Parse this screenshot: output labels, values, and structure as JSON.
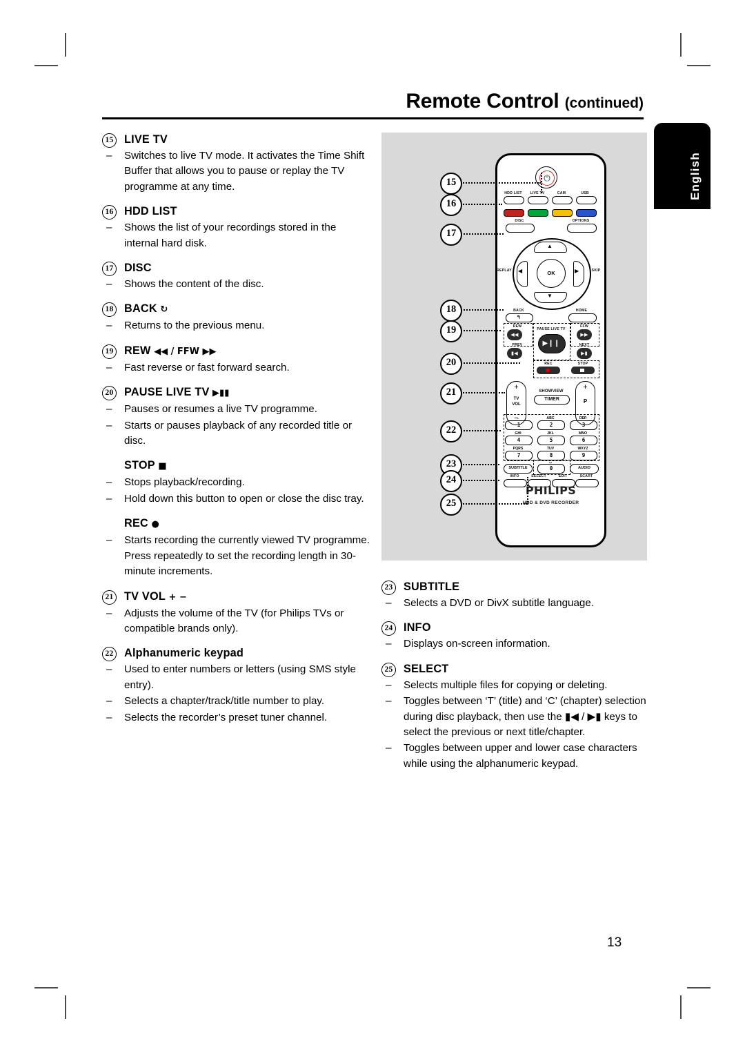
{
  "header": {
    "title": "Remote Control",
    "continued": "(continued)"
  },
  "side_tab": {
    "label": "English"
  },
  "page_number": "13",
  "left_column": [
    {
      "num": "15",
      "title": "LIVE TV",
      "items": [
        "Switches to live TV mode.  It activates the Time Shift Buffer that allows you to pause or replay the  TV programme at any time."
      ]
    },
    {
      "num": "16",
      "title": "HDD LIST",
      "items": [
        "Shows the list of your recordings stored in the internal hard disk."
      ]
    },
    {
      "num": "17",
      "title": "DISC",
      "items": [
        "Shows the content of the disc."
      ]
    },
    {
      "num": "18",
      "title": "BACK",
      "title_glyph": "↻",
      "items": [
        "Returns to the previous menu."
      ]
    },
    {
      "num": "19",
      "title": "REW",
      "title_glyph": "◀◀ / FFW ▶▶",
      "items": [
        "Fast reverse or fast forward search."
      ]
    },
    {
      "num": "20",
      "title": "PAUSE LIVE TV",
      "title_glyph": "▶▮▮",
      "items": [
        "Pauses or resumes a live TV programme.",
        "Starts or pauses playback of any recorded title or disc."
      ]
    },
    {
      "num": "",
      "title": "STOP",
      "title_glyph": "■",
      "items": [
        "Stops playback/recording.",
        "Hold down this button to open or close the disc tray."
      ]
    },
    {
      "num": "",
      "title": "REC",
      "title_glyph": "●",
      "items": [
        "Starts recording the currently viewed TV programme. Press repeatedly to set the recording length in 30-minute increments."
      ]
    },
    {
      "num": "21",
      "title": "TV VOL",
      "title_glyph": "+ −",
      "items": [
        "Adjusts the volume of the TV (for Philips TVs or compatible brands only)."
      ]
    },
    {
      "num": "22",
      "title": "Alphanumeric keypad",
      "title_case": "mixed",
      "items": [
        "Used to enter numbers or letters (using SMS style entry).",
        "Selects a chapter/track/title number to play.",
        "Selects the recorder’s preset tuner channel."
      ]
    }
  ],
  "right_column": [
    {
      "num": "23",
      "title": "SUBTITLE",
      "items": [
        "Selects a DVD or DivX subtitle language."
      ]
    },
    {
      "num": "24",
      "title": "INFO",
      "items": [
        "Displays on-screen information."
      ]
    },
    {
      "num": "25",
      "title": "SELECT",
      "items": [
        "Selects multiple files for copying or deleting.",
        "Toggles between ‘T’ (title) and ‘C’ (chapter) selection during disc playback, then use the ▮◀ / ▶▮ keys to select the previous or next title/chapter.",
        "Toggles between upper and lower case characters while using the alphanumeric keypad."
      ]
    }
  ],
  "diagram": {
    "callouts": [
      "15",
      "16",
      "17",
      "18",
      "19",
      "20",
      "21",
      "22",
      "23",
      "24",
      "25"
    ],
    "remote": {
      "brand": "PHILIPS",
      "model_line": "HDD & DVD RECORDER",
      "power_icon": "power-icon",
      "top_row": [
        "HDD LIST",
        "LIVE TV",
        "CAM",
        "USB"
      ],
      "color_buttons": [
        {
          "name": "red",
          "hex": "#C2221F"
        },
        {
          "name": "green",
          "hex": "#00A63C"
        },
        {
          "name": "yellow",
          "hex": "#F2C200"
        },
        {
          "name": "blue",
          "hex": "#2A54CC"
        }
      ],
      "disc_label": "DISC",
      "options_label": "OPTIONS",
      "dpad": {
        "ok": "OK",
        "left_label": "REPLAY",
        "right_label": "SKIP",
        "up": "▲",
        "down": "▼",
        "left": "◀",
        "right": "▶"
      },
      "back_label": "BACK",
      "home_label": "HOME",
      "transport": {
        "rew": "REW",
        "ffw": "FFW",
        "prev": "PREV",
        "next": "NEXT",
        "pause_live_tv": "PAUSE LIVE TV",
        "rec": "REC",
        "stop": "STOP"
      },
      "tv_vol": {
        "plus": "+",
        "minus": "−",
        "line1": "TV",
        "line2": "VOL"
      },
      "prog": {
        "plus": "+",
        "minus": "−",
        "label": "P"
      },
      "showview": "SHOWVIEW",
      "timer": "TIMER",
      "keypad": [
        {
          "letters": ".",
          "digit": "1"
        },
        {
          "letters": "ABC",
          "digit": "2"
        },
        {
          "letters": "DEF",
          "digit": "3"
        },
        {
          "letters": "GHI",
          "digit": "4"
        },
        {
          "letters": "JKL",
          "digit": "5"
        },
        {
          "letters": "MNO",
          "digit": "6"
        },
        {
          "letters": "PQRS",
          "digit": "7"
        },
        {
          "letters": "TUV",
          "digit": "8"
        },
        {
          "letters": "WXYZ",
          "digit": "9"
        }
      ],
      "zero_letters": "␣",
      "zero_digit": "0",
      "subtitle_label": "SUBTITLE",
      "audio_label": "AUDIO",
      "bottom_row": [
        "INFO",
        "SELECT",
        "EDIT",
        "SCART"
      ]
    }
  }
}
